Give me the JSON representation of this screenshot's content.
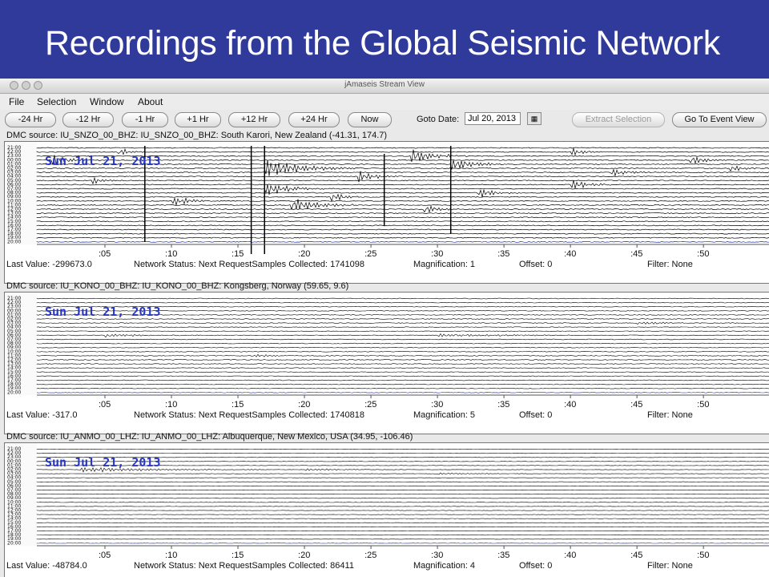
{
  "slide": {
    "title": "Recordings from the Global Seismic Network"
  },
  "window": {
    "title": "jAmaseis Stream View",
    "menu": [
      "File",
      "Selection",
      "Window",
      "About"
    ],
    "toolbar": {
      "buttons": [
        "-24 Hr",
        "-12 Hr",
        "-1 Hr",
        "+1 Hr",
        "+12 Hr",
        "+24 Hr",
        "Now"
      ],
      "goto_label": "Goto Date:",
      "goto_value": "Jul 20, 2013",
      "extract_label": "Extract Selection",
      "event_label": "Go To Event View"
    }
  },
  "panels": [
    {
      "header": "DMC source: IU_SNZO_00_BHZ: IU_SNZO_00_BHZ: South Karori, New Zealand (-41.31, 174.7)",
      "date": "Sun Jul 21, 2013",
      "hour_labels": [
        "21:00",
        "22:00",
        "23:00",
        "00:00",
        "01:00",
        "02:00",
        "03:00",
        "04:00",
        "05:00",
        "06:00",
        "07:00",
        "08:00",
        "09:00",
        "10:00",
        "11:00",
        "12:00",
        "13:00",
        "14:00",
        "15:00",
        "16:00",
        "17:00",
        "18:00",
        "19:00",
        "20:00"
      ],
      "minute_ticks": [
        ":05",
        ":10",
        ":15",
        ":20",
        ":25",
        ":30",
        ":35",
        ":40",
        ":45",
        ":50"
      ],
      "status": {
        "last_value": "Last Value:  -299673.0",
        "network": "Network Status:  Next RequestSamples Collected:  1741098",
        "magnification": "Magnification:  1",
        "offset": "Offset:  0",
        "filter": "Filter:  None"
      }
    },
    {
      "header": "DMC source: IU_KONO_00_BHZ: IU_KONO_00_BHZ: Kongsberg, Norway (59.65, 9.6)",
      "date": "Sun Jul 21, 2013",
      "hour_labels": [
        "21:00",
        "22:00",
        "23:00",
        "00:00",
        "01:00",
        "02:00",
        "03:00",
        "04:00",
        "05:00",
        "06:00",
        "07:00",
        "08:00",
        "09:00",
        "10:00",
        "11:00",
        "12:00",
        "13:00",
        "14:00",
        "15:00",
        "16:00",
        "17:00",
        "18:00",
        "19:00",
        "20:00"
      ],
      "minute_ticks": [
        ":05",
        ":10",
        ":15",
        ":20",
        ":25",
        ":30",
        ":35",
        ":40",
        ":45",
        ":50"
      ],
      "status": {
        "last_value": "Last Value:  -317.0",
        "network": "Network Status:  Next RequestSamples Collected:  1740818",
        "magnification": "Magnification:  5",
        "offset": "Offset:  0",
        "filter": "Filter:  None"
      }
    },
    {
      "header": "DMC source: IU_ANMO_00_LHZ: IU_ANMO_00_LHZ: Albuquerque, New Mexico, USA (34.95, -106.46)",
      "date": "Sun Jul 21, 2013",
      "hour_labels": [
        "21:00",
        "22:00",
        "23:00",
        "00:00",
        "01:00",
        "02:00",
        "03:00",
        "04:00",
        "05:00",
        "06:00",
        "07:00",
        "08:00",
        "09:00",
        "10:00",
        "11:00",
        "12:00",
        "13:00",
        "14:00",
        "15:00",
        "16:00",
        "17:00",
        "18:00",
        "19:00",
        "20:00"
      ],
      "minute_ticks": [
        ":05",
        ":10",
        ":15",
        ":20",
        ":25",
        ":30",
        ":35",
        ":40",
        ":45",
        ":50"
      ],
      "status": {
        "last_value": "Last Value:  -48784.0",
        "network": "Network Status:  Next RequestSamples Collected:  86411",
        "magnification": "Magnification:  4",
        "offset": "Offset:  0",
        "filter": "Filter:  None"
      }
    }
  ],
  "colors": {
    "slide_bg": "#2f3a9a",
    "date_label": "#2836c4",
    "trace": "#000000",
    "trace_accent": "#1b2bb5"
  }
}
